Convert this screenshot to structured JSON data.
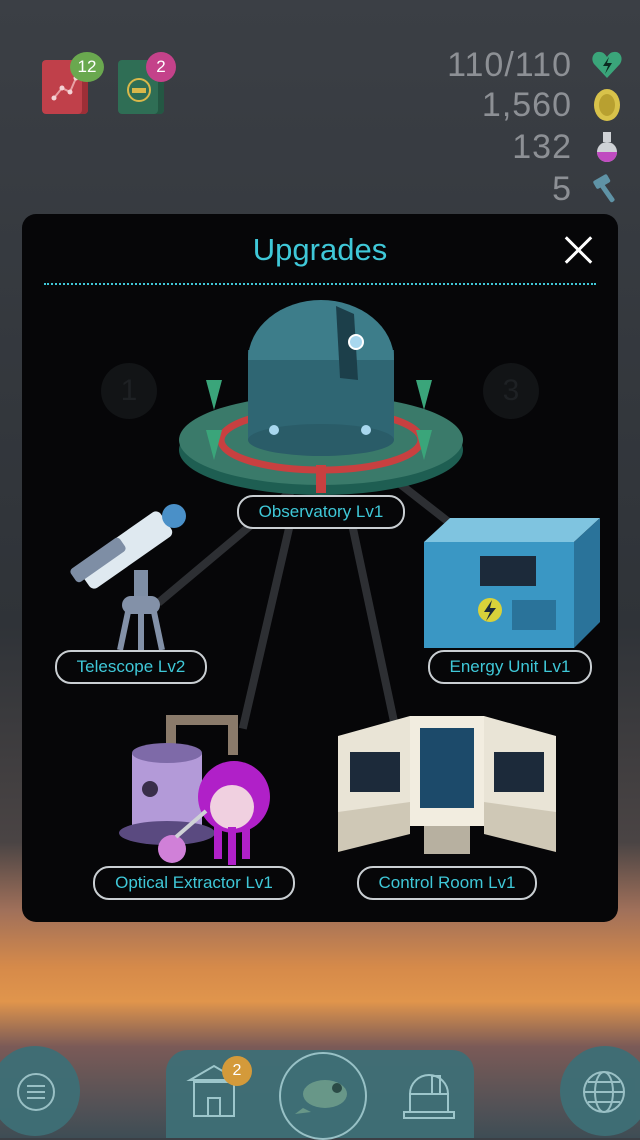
{
  "hud": {
    "books": [
      {
        "name": "constellation-book",
        "badge": "12",
        "color": "#c0404a"
      },
      {
        "name": "certificate-book",
        "badge": "2",
        "color": "#2f6e55"
      }
    ],
    "resources": [
      {
        "value": "110/110",
        "icon": "heart-lightning-icon"
      },
      {
        "value": "1,560",
        "icon": "coin-icon"
      },
      {
        "value": "132",
        "icon": "flask-icon"
      },
      {
        "value": "5",
        "icon": "hammer-icon"
      }
    ]
  },
  "panel": {
    "title": "Upgrades",
    "background_steps": [
      "1",
      "3"
    ],
    "upgrades": [
      {
        "label": "Observatory Lv1"
      },
      {
        "label": "Telescope Lv2"
      },
      {
        "label": "Energy Unit Lv1"
      },
      {
        "label": "Optical Extractor Lv1"
      },
      {
        "label": "Control Room Lv1"
      }
    ]
  },
  "nav": {
    "shop_badge": "2",
    "items": [
      "menu-icon",
      "shop-icon",
      "creature-icon",
      "observatory-icon",
      "globe-icon"
    ]
  },
  "colors": {
    "accent": "#3fc8d8",
    "panel": "#060608",
    "nav": "#3e6f76"
  }
}
